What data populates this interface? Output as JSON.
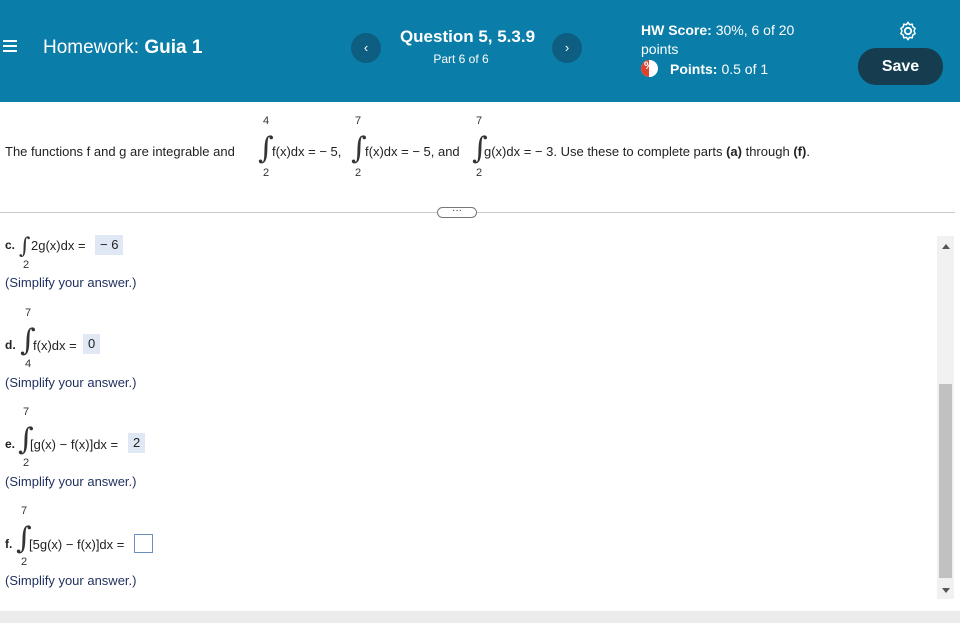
{
  "header": {
    "homework_prefix": "Homework:",
    "homework_name": "Guia 1",
    "question_title": "Question 5, 5.3.9",
    "question_part": "Part 6 of 6",
    "hw_score_label": "HW Score:",
    "hw_score_value": "30%, 6 of 20 points",
    "points_label": "Points:",
    "points_value": "0.5 of 1",
    "save_label": "Save",
    "prev_icon": "chevron-left-icon",
    "next_icon": "chevron-right-icon",
    "accent_color": "#0a7da8"
  },
  "statement": {
    "intro": "The functions f and g are integrable and",
    "int1": {
      "upper": "4",
      "lower": "2",
      "body": "f(x)dx = − 5,"
    },
    "int2": {
      "upper": "7",
      "lower": "2",
      "body": "f(x)dx = − 5, and"
    },
    "int3": {
      "upper": "7",
      "lower": "2",
      "body": "g(x)dx = − 3. Use these to complete parts"
    },
    "part_a": "(a)",
    "through": "through",
    "part_f": "(f)",
    "period": "."
  },
  "parts": {
    "c": {
      "label": "c.",
      "upper": "",
      "lower": "2",
      "body": "2g(x)dx =",
      "answer": "− 6",
      "hint": "(Simplify your answer.)"
    },
    "d": {
      "label": "d.",
      "upper": "7",
      "lower": "4",
      "body": "f(x)dx =",
      "answer": "0",
      "hint": "(Simplify your answer.)"
    },
    "e": {
      "label": "e.",
      "upper": "7",
      "lower": "2",
      "body": "[g(x) − f(x)]dx =",
      "answer": "2",
      "hint": "(Simplify your answer.)"
    },
    "f": {
      "label": "f.",
      "upper": "7",
      "lower": "2",
      "body": "[5g(x) − f(x)]dx =",
      "answer": "",
      "hint": "(Simplify your answer.)"
    }
  },
  "ellipsis": "···"
}
